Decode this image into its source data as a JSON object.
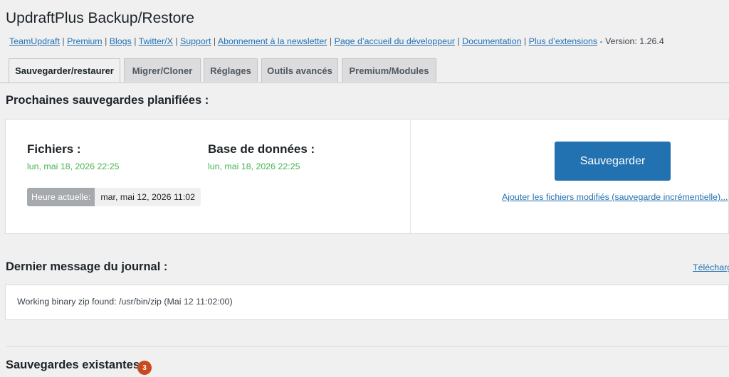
{
  "page": {
    "title": "UpdraftPlus Backup/Restore"
  },
  "links": {
    "items": [
      "TeamUpdraft",
      "Premium",
      "Blogs",
      "Twitter/X",
      "Support",
      "Abonnement à la newsletter",
      "Page d’accueil du développeur",
      "Documentation",
      "Plus d’extensions"
    ],
    "separator": "|",
    "version": "- Version: 1.26.4"
  },
  "tabs": [
    {
      "label": "Sauvegarder/restaurer",
      "active": true
    },
    {
      "label": "Migrer/Cloner",
      "active": false
    },
    {
      "label": "Réglages",
      "active": false
    },
    {
      "label": "Outils avancés",
      "active": false
    },
    {
      "label": "Premium/Modules",
      "active": false
    }
  ],
  "scheduled": {
    "heading": "Prochaines sauvegardes planifiées :",
    "files_label": "Fichiers :",
    "files_date": "lun, mai 18, 2026 22:25",
    "db_label": "Base de données :",
    "db_date": "lun, mai 18, 2026 22:25",
    "current_time_label": "Heure actuelle:",
    "current_time_value": "mar, mai 12, 2026 11:02",
    "backup_button": "Sauvegarder",
    "incremental_link": "Ajouter les fichiers modifiés (sauvegarde incrémentielle)..."
  },
  "log": {
    "heading": "Dernier message du journal :",
    "download_link": "Télécharg",
    "message": "Working binary zip found: /usr/bin/zip (Mai 12 11:02:00)"
  },
  "existing": {
    "heading": "Sauvegardes existantes",
    "count": "3"
  },
  "colors": {
    "accent": "#2271b1",
    "success": "#46b450",
    "badge": "#ca4a1f"
  }
}
